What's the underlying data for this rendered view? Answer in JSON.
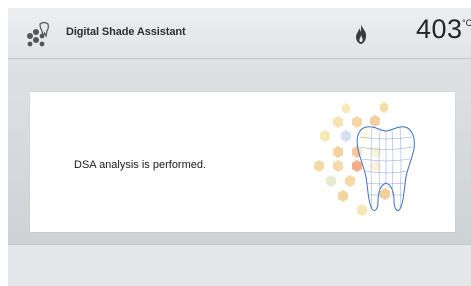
{
  "header": {
    "app_icon": "shade-hexagon-icon",
    "title": "Digital Shade Assistant",
    "status_icon": "flame-icon",
    "temperature": "403",
    "temperature_unit": "°C"
  },
  "main": {
    "message": "DSA analysis is performed.",
    "graphic": "tooth-shade-graphic"
  },
  "colors": {
    "background": "#d7d9dc",
    "card": "#ffffff",
    "tooth_outline": "#3f6fc4",
    "flame": "#3a3a3a"
  }
}
